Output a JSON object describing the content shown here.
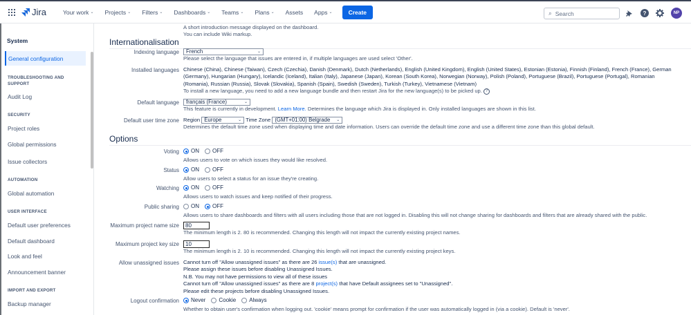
{
  "nav": {
    "logo": "Jira",
    "items": [
      "Your work",
      "Projects",
      "Filters",
      "Dashboards",
      "Teams",
      "Plans",
      "Assets",
      "Apps"
    ],
    "create": "Create",
    "search_placeholder": "Search",
    "avatar_initials": "NP"
  },
  "sidebar": {
    "title": "System",
    "active": "General configuration",
    "sections": [
      {
        "heading": "TROUBLESHOOTING AND SUPPORT",
        "items": [
          "Audit Log"
        ]
      },
      {
        "heading": "SECURITY",
        "items": [
          "Project roles",
          "Global permissions",
          "Issue collectors"
        ]
      },
      {
        "heading": "AUTOMATION",
        "items": [
          "Global automation"
        ]
      },
      {
        "heading": "USER INTERFACE",
        "items": [
          "Default user preferences",
          "Default dashboard",
          "Look and feel",
          "Announcement banner"
        ]
      },
      {
        "heading": "IMPORT AND EXPORT",
        "items": [
          "Backup manager"
        ]
      }
    ]
  },
  "top_desc": {
    "line1": "A short introduction message displayed on the dashboard.",
    "line2": "You can include Wiki markup."
  },
  "intl": {
    "heading": "Internationalisation",
    "indexing": {
      "label": "Indexing language",
      "value": "French",
      "desc": "Please select the language that issues are entered in, if multiple languages are used select 'Other'."
    },
    "installed": {
      "label": "Installed languages",
      "value": "Chinese (China), Chinese (Taiwan), Czech (Czechia), Danish (Denmark), Dutch (Netherlands), English (United Kingdom), English (United States), Estonian (Estonia), Finnish (Finland), French (France), German (Germany), Hungarian (Hungary), Icelandic (Iceland), Italian (Italy), Japanese (Japan), Korean (South Korea), Norwegian (Norway), Polish (Poland), Portuguese (Brazil), Portuguese (Portugal), Romanian (Romania), Russian (Russia), Slovak (Slovakia), Spanish (Spain), Swedish (Sweden), Turkish (Turkey), Vietnamese (Vietnam)",
      "desc": "To install a new language, you need to add a new language bundle and then restart Jira for the new language(s) to be picked up."
    },
    "default_lang": {
      "label": "Default language",
      "value": "français (France)",
      "desc_pre": "This feature is currently in development.",
      "link": "Learn More.",
      "desc_post": "Determines the language which Jira is displayed in. Only installed languages are shown in this list."
    },
    "timezone": {
      "label": "Default user time zone",
      "region_label": "Region",
      "region": "Europe",
      "tz_label": "Time Zone",
      "tz": "(GMT+01:00) Belgrade",
      "desc": "Determines the default time zone used when displaying time and date information. Users can override the default time zone and use a different time zone than this global default."
    }
  },
  "options": {
    "heading": "Options",
    "on": "ON",
    "off": "OFF",
    "voting": {
      "label": "Voting",
      "selected": "ON",
      "desc": "Allows users to vote on which issues they would like resolved."
    },
    "status": {
      "label": "Status",
      "selected": "ON",
      "desc": "Allow users to select a status for an issue they're creating."
    },
    "watching": {
      "label": "Watching",
      "selected": "ON",
      "desc": "Allows users to watch issues and keep notified of their progress."
    },
    "public_sharing": {
      "label": "Public sharing",
      "selected": "OFF",
      "desc": "Allows users to share dashboards and filters with all users including those that are not logged in. Disabling this will not change sharing for dashboards and filters that are already shared with the public."
    },
    "max_name": {
      "label": "Maximum project name size",
      "value": "80",
      "desc": "The minimum length is 2. 80 is recommended. Changing this length will not impact the currently existing project names."
    },
    "max_key": {
      "label": "Maximum project key size",
      "value": "10",
      "desc": "The minimum length is 2. 10 is recommended. Changing this length will not impact the currently existing project keys."
    },
    "unassigned": {
      "label": "Allow unassigned issues",
      "l1_pre": "Cannot turn off \"Allow unassigned issues\" as there are 26",
      "l1_link": "issue(s)",
      "l1_post": "that are unassigned.",
      "l2": "Please assign these issues before disabling Unassigned Issues.",
      "l3": "N.B. You may not have permissions to view all of these issues",
      "l4_pre": "Cannot turn off \"Allow unassigned issues\" as there are 8",
      "l4_link": "project(s)",
      "l4_post": "that have Default assignees set to \"Unassigned\".",
      "l5": "Please edit these projects before disabling Unassigned Issues."
    },
    "logout": {
      "label": "Logout confirmation",
      "choices": [
        "Never",
        "Cookie",
        "Always"
      ],
      "selected": "Never",
      "desc": "Whether to obtain user's confirmation when logging out. 'cookie' means prompt for confirmation if the user was automatically logged in (via a cookie). Default is 'never'."
    }
  }
}
